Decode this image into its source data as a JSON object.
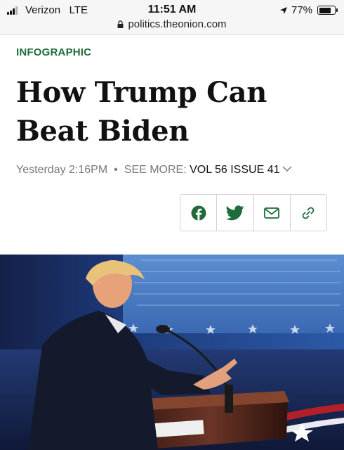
{
  "status_bar": {
    "carrier": "Verizon",
    "network": "LTE",
    "time": "11:51 AM",
    "battery": "77%",
    "battery_level": 0.77
  },
  "url_bar": {
    "url": "politics.theonion.com"
  },
  "article": {
    "section": "INFOGRAPHIC",
    "headline_line1": "How Trump Can",
    "headline_line2": "Beat Biden",
    "timestamp": "Yesterday 2:16PM",
    "bullet": "•",
    "see_more": "SEE MORE:",
    "issue": "VOL 56 ISSUE 41"
  },
  "share": {
    "buttons": [
      {
        "icon": "facebook-icon"
      },
      {
        "icon": "twitter-icon"
      },
      {
        "icon": "email-icon"
      },
      {
        "icon": "link-icon"
      }
    ],
    "color": "#1f6b3a"
  },
  "hero": {
    "description_icon": "photo"
  }
}
